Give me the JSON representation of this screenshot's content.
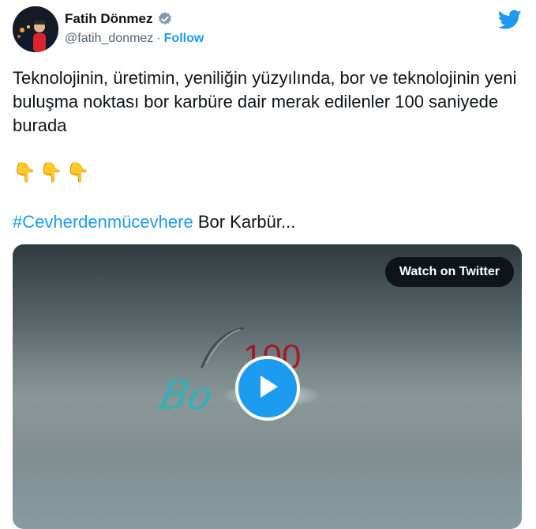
{
  "author": {
    "display_name": "Fatih Dönmez",
    "handle": "@fatih_donmez",
    "separator": "·",
    "follow_label": "Follow"
  },
  "tweet": {
    "text": "Teknolojinin, üretimin, yeniliğin yüzyılında, bor ve teknolojinin yeni buluşma noktası bor karbüre dair merak edilenler 100 saniyede burada",
    "emojis": "👇👇👇",
    "hashtag": "#Cevherdenmücevhere",
    "hashtag_tail": " Bor Karbür..."
  },
  "media": {
    "watch_label": "Watch on Twitter",
    "video_logo_text": "Bo",
    "video_number": "100"
  },
  "colors": {
    "accent": "#1d9bf0",
    "text": "#0f1419",
    "muted": "#536471"
  },
  "icons": {
    "verified": "verified-badge-icon",
    "brand": "twitter-bird-icon",
    "play": "play-icon"
  }
}
